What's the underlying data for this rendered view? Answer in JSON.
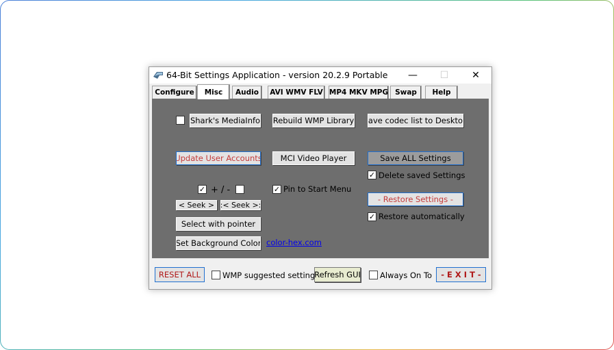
{
  "window": {
    "title": "64-Bit Settings Application - version 20.2.9 Portable",
    "min_symbol": "—",
    "max_symbol": "☐",
    "close_symbol": "✕"
  },
  "tabs": [
    {
      "label": "Configure"
    },
    {
      "label": "Misc",
      "active": true
    },
    {
      "label": "Audio"
    },
    {
      "label": "AVI WMV FLV"
    },
    {
      "label": "MP4 MKV MPG"
    },
    {
      "label": "Swap"
    },
    {
      "label": "Help"
    }
  ],
  "misc": {
    "mediainfo_checked": false,
    "mediainfo_label": "Shark's MediaInfo",
    "rebuild_wmp_label": "Rebuild WMP Library",
    "save_codec_label": "Save codec list to Desktop",
    "update_accounts_label": "Update User Accounts",
    "mci_player_label": "MCI Video Player",
    "save_all_label": "Save ALL Settings",
    "delete_saved_checked": true,
    "delete_saved_label": "Delete saved Settings",
    "plus_checked": true,
    "plus_minus_label": "+ / -",
    "minus_checked": false,
    "pin_start_checked": true,
    "pin_start_label": "Pin to Start Menu",
    "seek_back_label": "<  Seek  >",
    "seek_fwd_label": ":< Seek >:",
    "restore_settings_label": "- Restore Settings -",
    "restore_auto_checked": true,
    "restore_auto_label": "Restore automatically",
    "select_pointer_label": "Select with pointer",
    "set_bg_label": "Set Background Color",
    "color_link_label": "color-hex.com"
  },
  "footer": {
    "reset_all_label": "RESET ALL",
    "wmp_suggested_checked": false,
    "wmp_suggested_label": "WMP suggested settings",
    "refresh_gui_label": "Refresh GUI",
    "always_on_top_checked": false,
    "always_on_top_label": "Always On Top",
    "exit_label": "-  E X I T  -"
  },
  "colors": {
    "panel_bg": "#6e6e6e",
    "accent_red": "#c43b3b",
    "exit_red": "#b01818",
    "link_blue": "#0000ee",
    "focus_blue": "#1f6fd0"
  }
}
